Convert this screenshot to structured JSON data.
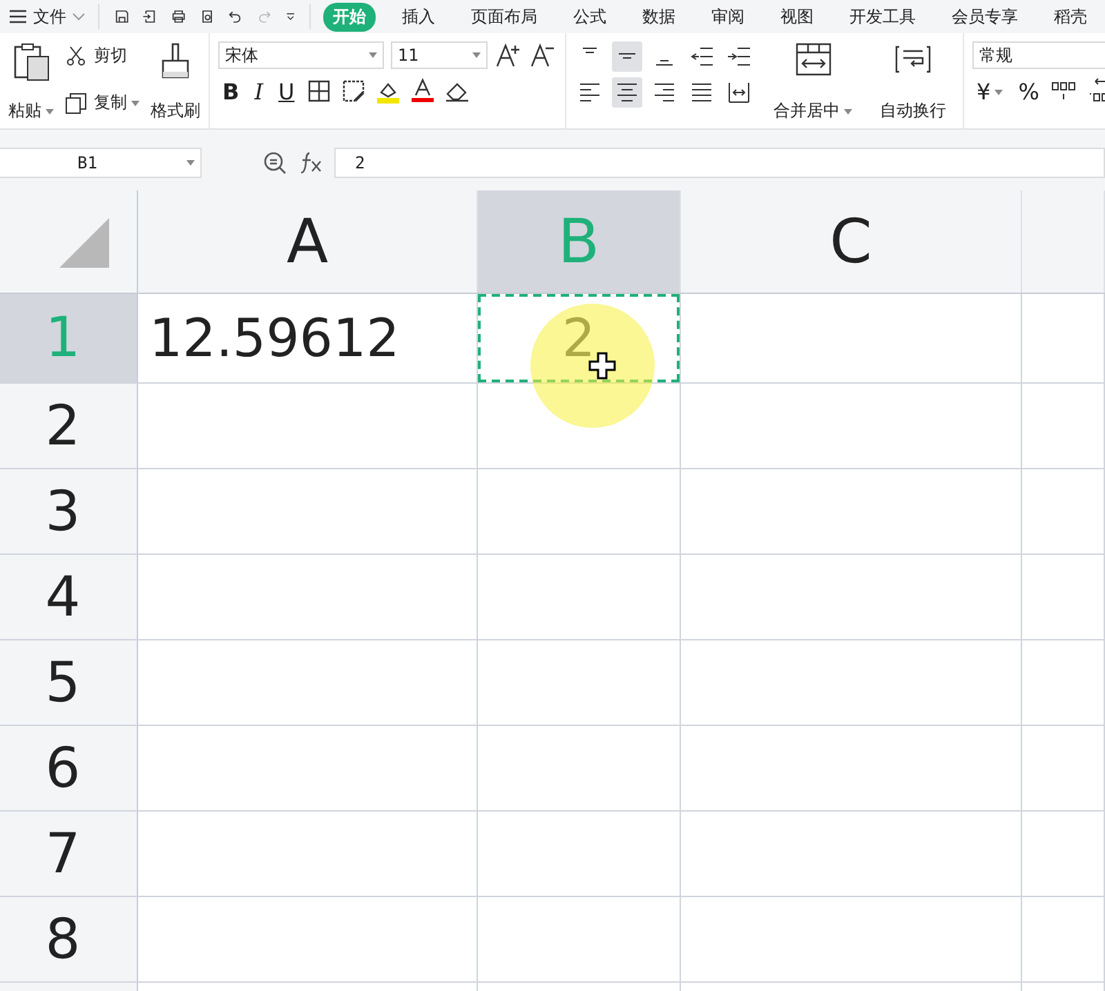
{
  "menu": {
    "file_label": "文件",
    "tabs": [
      {
        "label": "开始",
        "selected": true
      },
      {
        "label": "插入",
        "selected": false
      },
      {
        "label": "页面布局",
        "selected": false
      },
      {
        "label": "公式",
        "selected": false
      },
      {
        "label": "数据",
        "selected": false
      },
      {
        "label": "审阅",
        "selected": false
      },
      {
        "label": "视图",
        "selected": false
      },
      {
        "label": "开发工具",
        "selected": false
      },
      {
        "label": "会员专享",
        "selected": false
      },
      {
        "label": "稻壳",
        "selected": false
      }
    ]
  },
  "ribbon": {
    "paste": "粘贴",
    "cut": "剪切",
    "copy": "复制",
    "format_painter": "格式刷",
    "font_name": "宋体",
    "font_size": "11",
    "bold": "B",
    "italic": "I",
    "underline": "U",
    "align_top": [
      {
        "kind": "top",
        "selected": false
      },
      {
        "kind": "middle",
        "selected": true
      },
      {
        "kind": "bottom",
        "selected": false
      },
      {
        "kind": "outdent",
        "selected": false
      },
      {
        "kind": "indent",
        "selected": false
      }
    ],
    "align_bottom": [
      {
        "kind": "left",
        "selected": false
      },
      {
        "kind": "center",
        "selected": true
      },
      {
        "kind": "right",
        "selected": false
      },
      {
        "kind": "justify",
        "selected": false
      },
      {
        "kind": "distribute",
        "selected": false
      }
    ],
    "merge": "合并居中",
    "wrap": "自动换行",
    "number_format": "常规",
    "currency": "¥",
    "percent": "%"
  },
  "formula_bar": {
    "name_box": "B1",
    "formula": "2"
  },
  "grid": {
    "columns": [
      {
        "label": "A",
        "selected": false
      },
      {
        "label": "B",
        "selected": true
      },
      {
        "label": "C",
        "selected": false
      }
    ],
    "rows": [
      {
        "label": "1",
        "selected": true,
        "cells": [
          {
            "value": "12.59612",
            "selected": false
          },
          {
            "value": "2",
            "selected": true
          }
        ]
      },
      {
        "label": "2",
        "selected": false
      },
      {
        "label": "3",
        "selected": false
      },
      {
        "label": "4",
        "selected": false
      },
      {
        "label": "5",
        "selected": false
      },
      {
        "label": "6",
        "selected": false
      },
      {
        "label": "7",
        "selected": false
      },
      {
        "label": "8",
        "selected": false
      }
    ]
  }
}
